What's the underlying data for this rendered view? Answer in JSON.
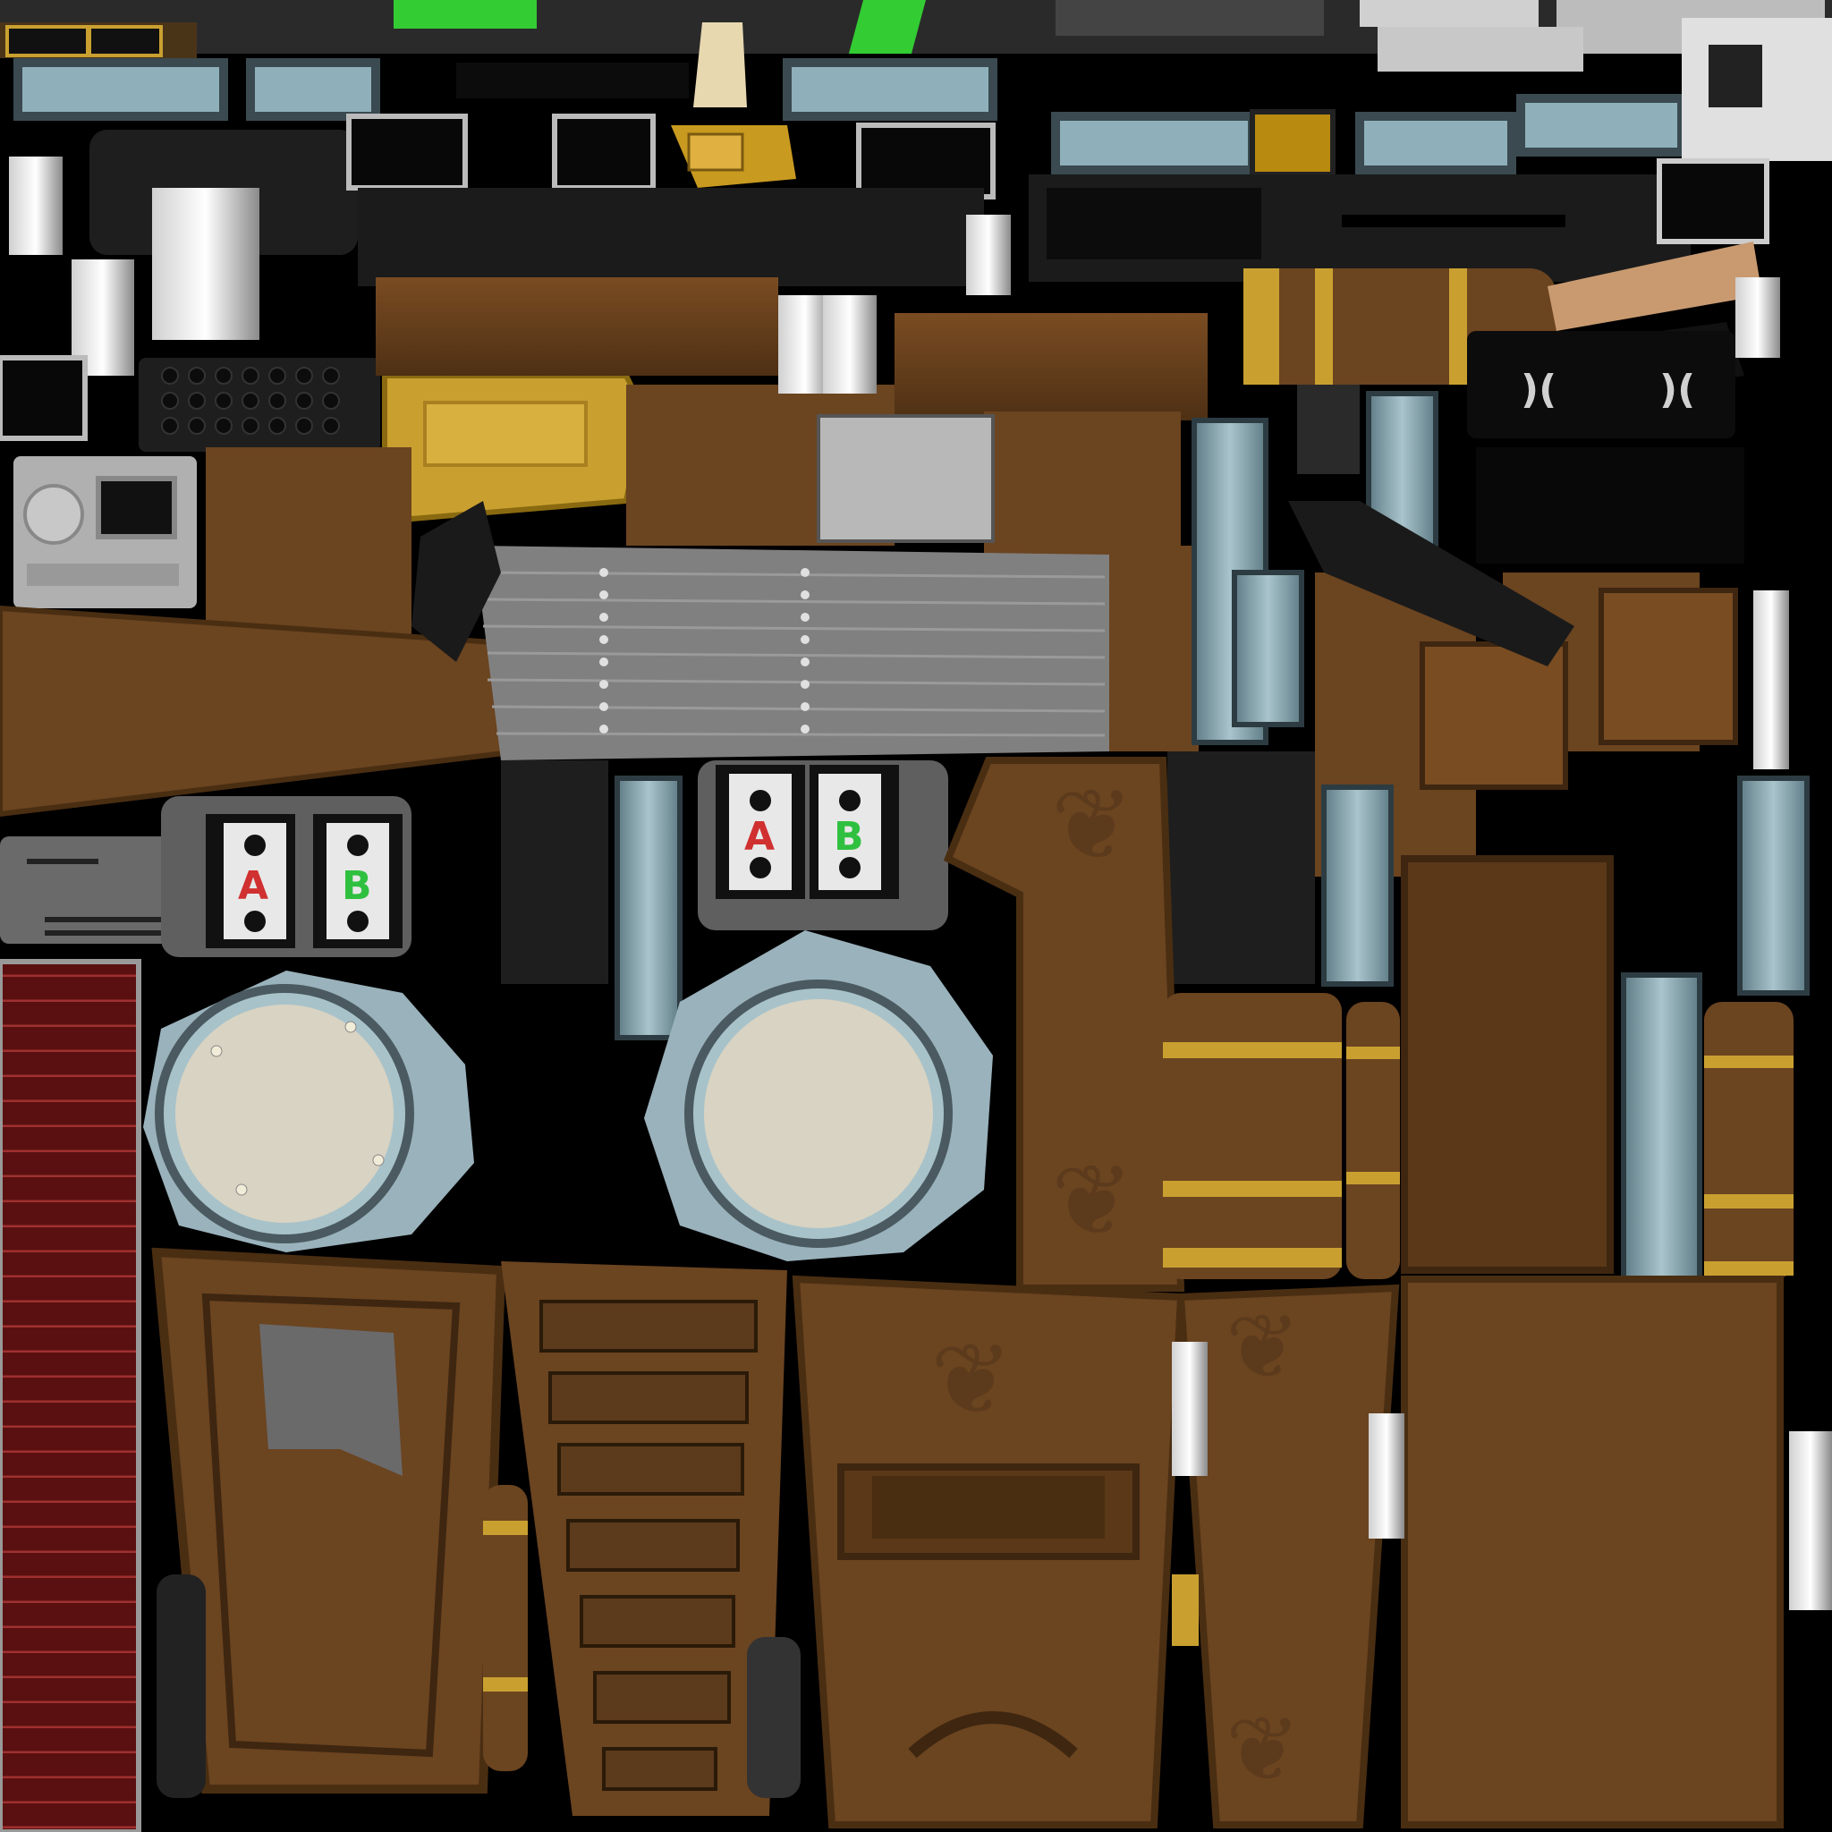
{
  "texture": {
    "labels": {
      "a_left": "A",
      "b_left": "B",
      "a_right": "A",
      "b_right": "B"
    },
    "colors": {
      "background": "#000000",
      "wood": "#6b4420",
      "wood_dark": "#4a2e12",
      "wood_light": "#8a5a2c",
      "steel": "#7fa0ad",
      "steel_light": "#a9c4cc",
      "black_plastic": "#1c1c1c",
      "gray_metal": "#7a7a7a",
      "brass": "#c9a030",
      "cream": "#d8d3c2",
      "red_label": "#d03030",
      "green_label": "#30c040",
      "green_led": "#33cc33",
      "maroon": "#5a1010",
      "leather_tan": "#c99a70"
    }
  }
}
